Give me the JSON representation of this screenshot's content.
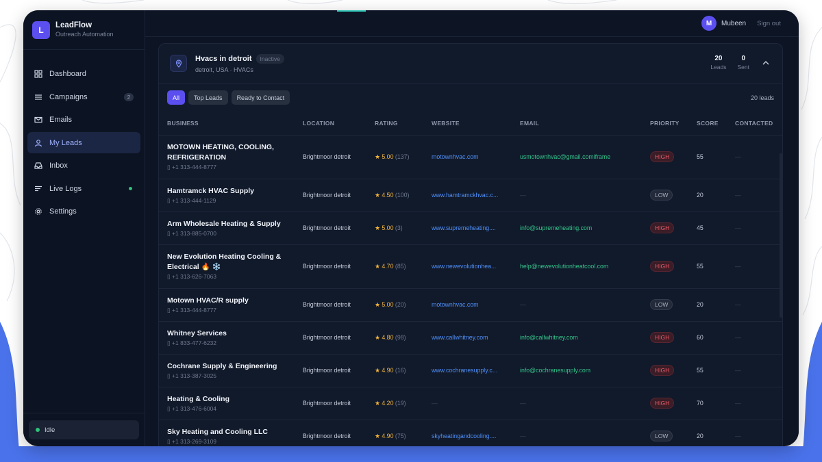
{
  "app": {
    "name": "LeadFlow",
    "subtitle": "Outreach Automation",
    "logo_letter": "L"
  },
  "sidebar": {
    "items": [
      {
        "label": "Dashboard",
        "icon": "grid-icon"
      },
      {
        "label": "Campaigns",
        "icon": "list-icon",
        "badge": "2"
      },
      {
        "label": "Emails",
        "icon": "mail-icon"
      },
      {
        "label": "My Leads",
        "icon": "user-icon",
        "active": true
      },
      {
        "label": "Inbox",
        "icon": "inbox-icon"
      },
      {
        "label": "Live Logs",
        "icon": "log-icon",
        "status_dot": "green"
      },
      {
        "label": "Settings",
        "icon": "gear-icon"
      }
    ],
    "status": "Idle"
  },
  "topbar": {
    "avatar_letter": "M",
    "user_name": "Mubeen",
    "sign_out": "Sign out"
  },
  "campaign": {
    "title": "Hvacs in detroit",
    "status": "Inactive",
    "subtitle": "detroit, USA · HVACs",
    "leads_count": "20",
    "leads_label": "Leads",
    "sent_count": "0",
    "sent_label": "Sent"
  },
  "filters": {
    "all": "All",
    "top": "Top Leads",
    "ready": "Ready to Contact",
    "lead_count": "20 leads"
  },
  "table": {
    "headers": [
      "BUSINESS",
      "LOCATION",
      "RATING",
      "WEBSITE",
      "EMAIL",
      "PRIORITY",
      "SCORE",
      "CONTACTED"
    ],
    "rows": [
      {
        "name": "MOTOWN HEATING, COOLING, REFRIGERATION",
        "phone": "+1 313-444-8777",
        "location": "Brightmoor detroit",
        "rating": "5.00",
        "reviews": "(137)",
        "website": "motownhvac.com",
        "email": "usmotownhvac@gmail.comiframe",
        "priority": "HIGH",
        "score": "55",
        "contacted": "—"
      },
      {
        "name": "Hamtramck HVAC Supply",
        "phone": "+1 313-444-1129",
        "location": "Brightmoor detroit",
        "rating": "4.50",
        "reviews": "(100)",
        "website": "www.hamtramckhvac.c...",
        "email": "—",
        "priority": "LOW",
        "score": "20",
        "contacted": "—"
      },
      {
        "name": "Arm Wholesale Heating & Supply",
        "phone": "+1 313-885-0700",
        "location": "Brightmoor detroit",
        "rating": "5.00",
        "reviews": "(3)",
        "website": "www.supremeheating....",
        "email": "info@supremeheating.com",
        "priority": "HIGH",
        "score": "45",
        "contacted": "—"
      },
      {
        "name": "New Evolution Heating Cooling & Electrical 🔥 ❄️",
        "phone": "+1 313-626-7063",
        "location": "Brightmoor detroit",
        "rating": "4.70",
        "reviews": "(85)",
        "website": "www.newevolutionhea...",
        "email": "help@newevolutionheatcool.com",
        "priority": "HIGH",
        "score": "55",
        "contacted": "—"
      },
      {
        "name": "Motown HVAC/R supply",
        "phone": "+1 313-444-8777",
        "location": "Brightmoor detroit",
        "rating": "5.00",
        "reviews": "(20)",
        "website": "motownhvac.com",
        "email": "—",
        "priority": "LOW",
        "score": "20",
        "contacted": "—"
      },
      {
        "name": "Whitney Services",
        "phone": "+1 833-477-6232",
        "location": "Brightmoor detroit",
        "rating": "4.80",
        "reviews": "(98)",
        "website": "www.callwhitney.com",
        "email": "info@callwhitney.com",
        "priority": "HIGH",
        "score": "60",
        "contacted": "—"
      },
      {
        "name": "Cochrane Supply & Engineering",
        "phone": "+1 313-387-3025",
        "location": "Brightmoor detroit",
        "rating": "4.90",
        "reviews": "(16)",
        "website": "www.cochranesupply.c...",
        "email": "info@cochranesupply.com",
        "priority": "HIGH",
        "score": "55",
        "contacted": "—"
      },
      {
        "name": "Heating & Cooling",
        "phone": "+1 313-476-6004",
        "location": "Brightmoor detroit",
        "rating": "4.20",
        "reviews": "(19)",
        "website": "—",
        "email": "—",
        "priority": "HIGH",
        "score": "70",
        "contacted": "—"
      },
      {
        "name": "Sky Heating and Cooling LLC",
        "phone": "+1 313-269-3109",
        "location": "Brightmoor detroit",
        "rating": "4.90",
        "reviews": "(75)",
        "website": "skyheatingandcooling....",
        "email": "—",
        "priority": "LOW",
        "score": "20",
        "contacted": "—"
      }
    ]
  },
  "colors": {
    "accent": "#5b4ff0",
    "background": "#0d1424",
    "high": "#ef5b6b",
    "email": "#33c58a",
    "link": "#4f8ff7",
    "star": "#f5b73b"
  }
}
